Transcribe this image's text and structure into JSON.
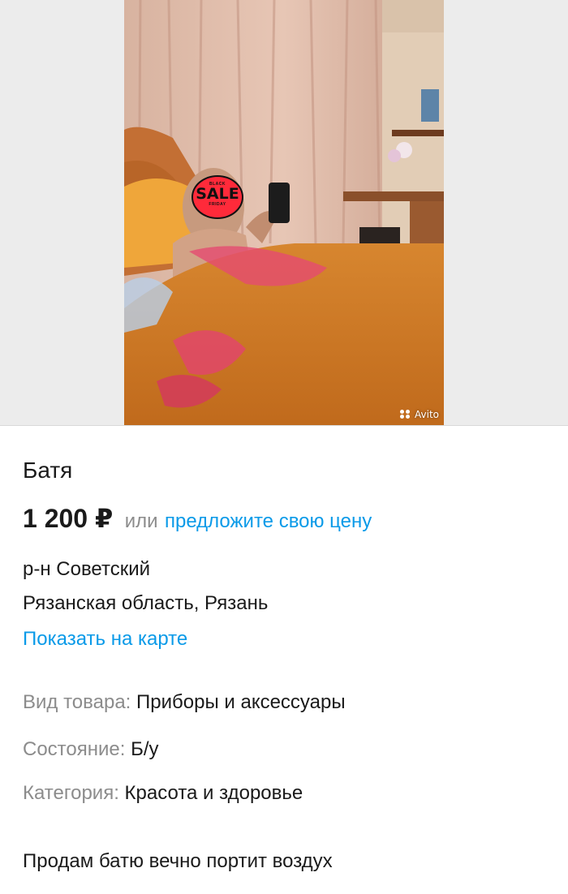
{
  "photo": {
    "watermark": "Avito",
    "badge": {
      "top": "BLACK",
      "main": "SALE",
      "bottom": "FRIDAY"
    }
  },
  "listing": {
    "title": "Батя",
    "price": "1 200 ₽",
    "price_or": "или",
    "offer_link": "предложите свою цену",
    "district": "р-н Советский",
    "region_city": "Рязанская область, Рязань",
    "map_link": "Показать на карте",
    "params": [
      {
        "key": "Вид товара:",
        "value": "Приборы и аксессуары"
      },
      {
        "key": "Состояние:",
        "value": "Б/у"
      },
      {
        "key": "Категория:",
        "value": "Красота и здоровье"
      }
    ],
    "description": "Продам батю вечно портит воздух"
  },
  "colors": {
    "link": "#0a9ae8",
    "muted": "#8c8c8c",
    "text": "#1a1a1a"
  }
}
